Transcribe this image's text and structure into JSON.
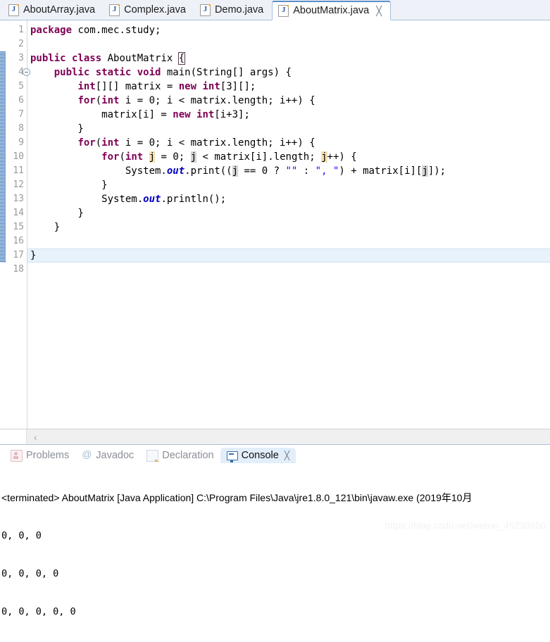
{
  "editor_tabs": [
    {
      "label": "AboutArray.java",
      "icon": "java-file-icon",
      "active": false,
      "closable": false
    },
    {
      "label": "Complex.java",
      "icon": "java-file-icon",
      "active": false,
      "closable": false
    },
    {
      "label": "Demo.java",
      "icon": "java-file-icon",
      "active": false,
      "closable": false
    },
    {
      "label": "AboutMatrix.java",
      "icon": "java-file-icon",
      "active": true,
      "closable": true
    }
  ],
  "tab_close_glyph": "╳",
  "gutter": {
    "line_numbers": [
      "1",
      "2",
      "3",
      "4",
      "5",
      "6",
      "7",
      "8",
      "9",
      "10",
      "11",
      "12",
      "13",
      "14",
      "15",
      "16",
      "17",
      "18"
    ],
    "fold_marker_line": 4,
    "fold_glyph": "⊖",
    "change_bar_from_line": 3,
    "change_bar_to_line": 17
  },
  "code": {
    "current_line": 17,
    "lines": [
      {
        "n": 1,
        "text": "package com.mec.study;"
      },
      {
        "n": 2,
        "text": ""
      },
      {
        "n": 3,
        "text": "public class AboutMatrix {"
      },
      {
        "n": 4,
        "text": "    public static void main(String[] args) {"
      },
      {
        "n": 5,
        "text": "        int[][] matrix = new int[3][];"
      },
      {
        "n": 6,
        "text": "        for(int i = 0; i < matrix.length; i++) {"
      },
      {
        "n": 7,
        "text": "            matrix[i] = new int[i+3];"
      },
      {
        "n": 8,
        "text": "        }"
      },
      {
        "n": 9,
        "text": "        for(int i = 0; i < matrix.length; i++) {"
      },
      {
        "n": 10,
        "text": "            for(int j = 0; j < matrix[i].length; j++) {"
      },
      {
        "n": 11,
        "text": "                System.out.print((j == 0 ? \"\" : \", \") + matrix[i][j]);"
      },
      {
        "n": 12,
        "text": "            }"
      },
      {
        "n": 13,
        "text": "            System.out.println();"
      },
      {
        "n": 14,
        "text": "        }"
      },
      {
        "n": 15,
        "text": "    }"
      },
      {
        "n": 16,
        "text": ""
      },
      {
        "n": 17,
        "text": "}"
      },
      {
        "n": 18,
        "text": ""
      }
    ]
  },
  "editor_hscroll": {
    "chevron_glyph": "‹"
  },
  "view_tabs": [
    {
      "label": "Problems",
      "icon": "problems-icon",
      "active": false,
      "closable": false
    },
    {
      "label": "Javadoc",
      "icon": "javadoc-icon",
      "active": false,
      "closable": false
    },
    {
      "label": "Declaration",
      "icon": "declaration-icon",
      "active": false,
      "closable": false
    },
    {
      "label": "Console",
      "icon": "console-icon",
      "active": true,
      "closable": true
    }
  ],
  "console": {
    "header": "<terminated> AboutMatrix [Java Application] C:\\Program Files\\Java\\jre1.8.0_121\\bin\\javaw.exe (2019年10月",
    "output": [
      "0, 0, 0",
      "0, 0, 0, 0",
      "0, 0, 0, 0, 0"
    ]
  },
  "watermark": "https://blog.csdn.net/weixin_45238600",
  "colors": {
    "keyword": "#7f0055",
    "string": "#2a00ff",
    "field": "#0000c0",
    "current_line": "#e8f2fb",
    "tab_active_border": "#5a8fc8",
    "occurrence_write": "#f4e0b4",
    "occurrence_read": "#d4d4d4"
  }
}
